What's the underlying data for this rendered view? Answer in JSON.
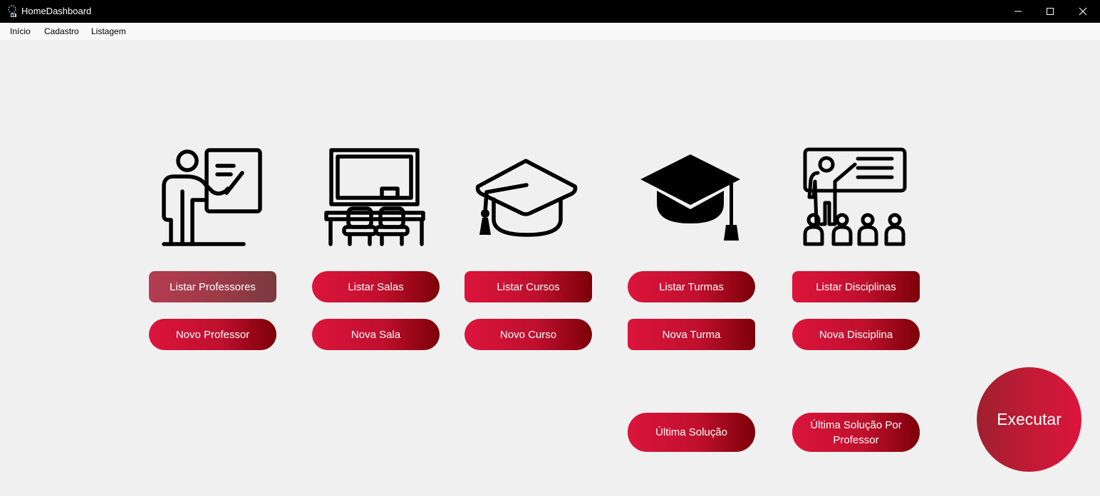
{
  "window": {
    "title": "HomeDashboard",
    "controls": [
      "minimize-icon",
      "maximize-icon",
      "close-icon"
    ]
  },
  "menu": {
    "items": [
      {
        "label": "Início"
      },
      {
        "label": "Cadastro"
      },
      {
        "label": "Listagem"
      }
    ]
  },
  "cards": [
    {
      "icon": "teacher-board-icon",
      "list_label": "Listar Professores",
      "new_label": "Novo Professor"
    },
    {
      "icon": "classroom-icon",
      "list_label": "Listar Salas",
      "new_label": "Nova Sala"
    },
    {
      "icon": "graduation-cap-outline-icon",
      "list_label": "Listar Cursos",
      "new_label": "Novo Curso"
    },
    {
      "icon": "graduation-cap-filled-icon",
      "list_label": "Listar Turmas",
      "new_label": "Nova Turma"
    },
    {
      "icon": "teacher-students-icon",
      "list_label": "Listar Disciplinas",
      "new_label": "Nova Disciplina"
    }
  ],
  "solutions": {
    "last_label": "Última Solução",
    "last_by_teacher_label": "Última Solução Por Professor"
  },
  "execute_label": "Executar",
  "colors": {
    "button_start": "#dc143c",
    "button_end": "#7c0008",
    "button_hover": "#b43c50",
    "background": "#f0f0f0",
    "titlebar": "#000000"
  }
}
